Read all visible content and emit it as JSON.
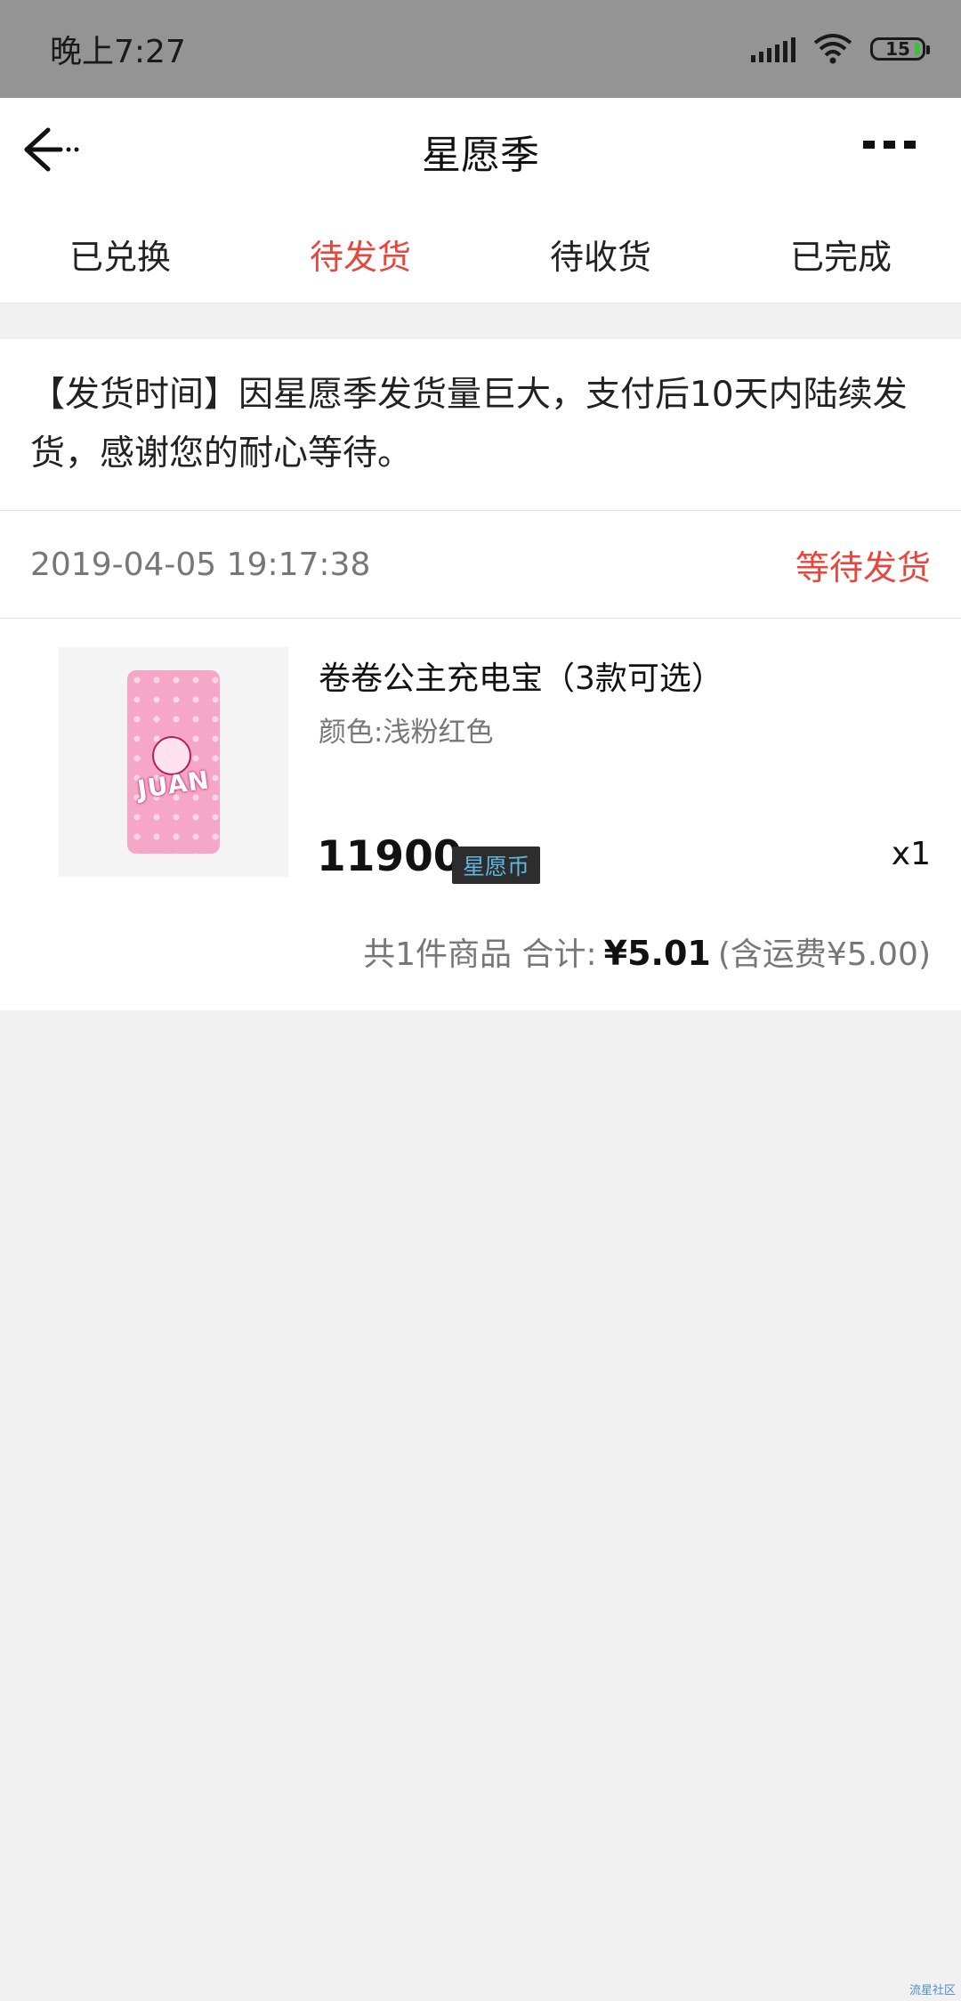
{
  "status_bar": {
    "time": "晚上7:27",
    "battery": "15"
  },
  "nav": {
    "title": "星愿季"
  },
  "tabs": [
    {
      "label": "已兑换",
      "active": false
    },
    {
      "label": "待发货",
      "active": true
    },
    {
      "label": "待收货",
      "active": false
    },
    {
      "label": "已完成",
      "active": false
    }
  ],
  "notice": {
    "text": "【发货时间】因星愿季发货量巨大，支付后10天内陆续发货，感谢您的耐心等待。"
  },
  "order": {
    "time": "2019-04-05 19:17:38",
    "status": "等待发货",
    "product": {
      "name": "卷卷公主充电宝（3款可选）",
      "spec": "颜色:浅粉红色",
      "image_text": "JUAN",
      "price": "11900",
      "currency": "星愿币",
      "quantity": "x1"
    },
    "summary": {
      "count_text": "共1件商品 合计:",
      "amount": "¥5.01",
      "shipping": "(含运费¥5.00)"
    }
  },
  "watermark": "流星社区",
  "colors": {
    "accent": "#e8453c",
    "status_bar": "#949494",
    "coin_badge_bg": "#2d2d2d"
  }
}
